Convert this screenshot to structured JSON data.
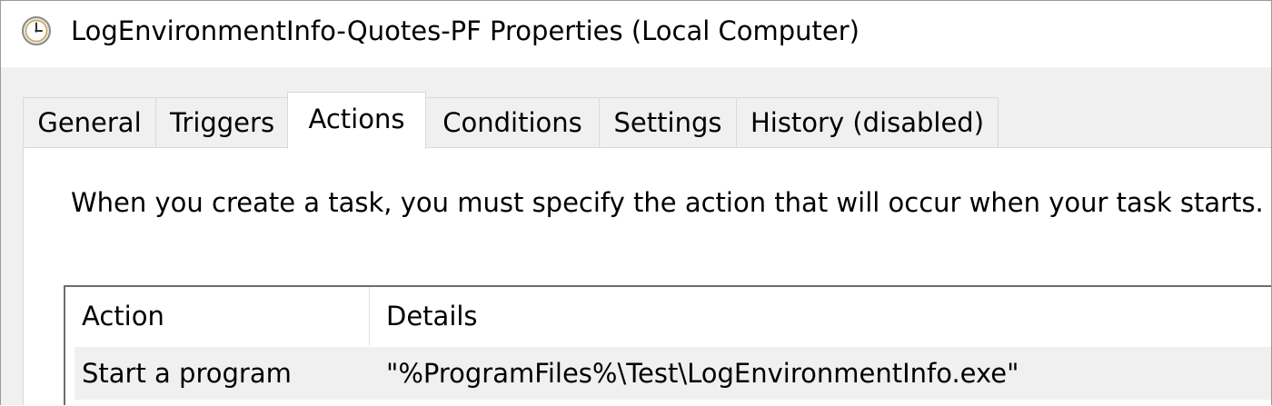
{
  "window": {
    "title": "LogEnvironmentInfo-Quotes-PF Properties (Local Computer)",
    "icon": "clock-icon"
  },
  "tabs": [
    {
      "label": "General",
      "active": false
    },
    {
      "label": "Triggers",
      "active": false
    },
    {
      "label": "Actions",
      "active": true
    },
    {
      "label": "Conditions",
      "active": false
    },
    {
      "label": "Settings",
      "active": false
    },
    {
      "label": "History (disabled)",
      "active": false
    }
  ],
  "actions_panel": {
    "description": "When you create a task, you must specify the action that will occur when your task starts.",
    "columns": {
      "action": "Action",
      "details": "Details"
    },
    "rows": [
      {
        "action": "Start a program",
        "details": "\"%ProgramFiles%\\Test\\LogEnvironmentInfo.exe\""
      }
    ]
  },
  "colors": {
    "window_bg": "#f0f0f0",
    "panel_bg": "#ffffff",
    "row_bg": "#f0f0f0",
    "border": "#d9d9d9"
  }
}
